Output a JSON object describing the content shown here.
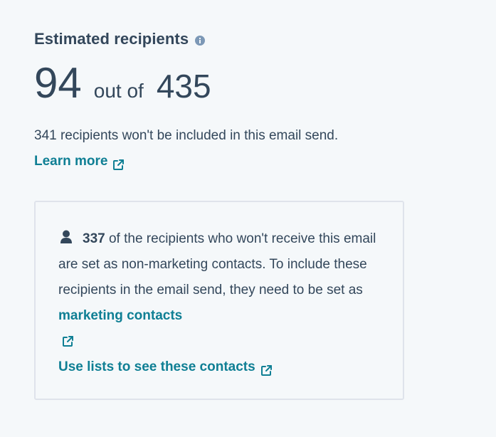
{
  "header": {
    "title": "Estimated recipients"
  },
  "count": {
    "included": "94",
    "separator": "out of",
    "total": "435"
  },
  "summary": {
    "text": "341 recipients won't be included in this email send.",
    "learn_more": "Learn more"
  },
  "notice": {
    "count": "337",
    "text_part1": " of the recipients who won't receive this email are set as non-marketing contacts. To include these recipients in the email send, they need to be set as ",
    "marketing_link": "marketing contacts",
    "lists_link": "Use lists to see these contacts"
  },
  "colors": {
    "text": "#33475b",
    "link": "#0f7f94",
    "background": "#f5f8fa",
    "border": "#dfe3eb"
  },
  "icons": {
    "info": "info-icon",
    "external": "external-link-icon",
    "person": "person-icon"
  }
}
